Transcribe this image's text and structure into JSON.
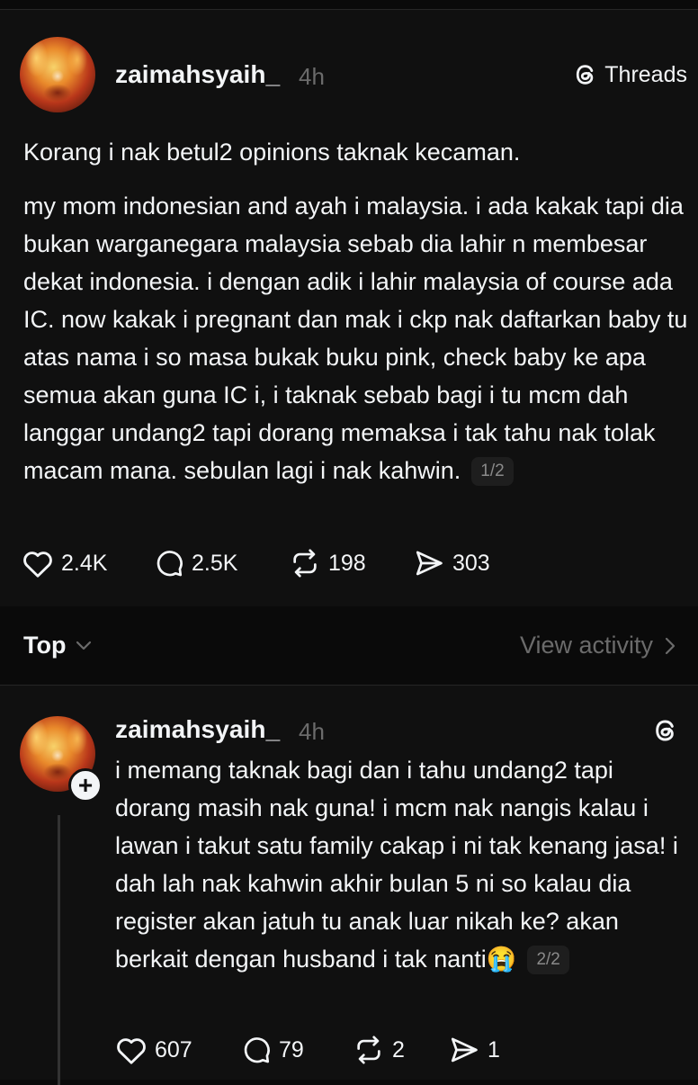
{
  "post": {
    "username": "zaimahsyaih_",
    "time": "4h",
    "brand_label": "Threads",
    "paragraph1": "Korang i nak betul2 opinions taknak kecaman.",
    "paragraph2": "my mom indonesian and ayah i malaysia. i ada kakak tapi dia bukan warganegara malaysia sebab dia lahir n membesar dekat indonesia. i dengan adik i lahir malaysia of course ada IC. now kakak i pregnant dan mak i ckp nak daftarkan baby tu atas nama i so masa bukak buku pink, check baby ke apa semua akan guna IC i, i taknak sebab bagi i tu mcm dah langgar undang2 tapi dorang memaksa i tak tahu nak tolak macam mana. sebulan lagi i nak kahwin.",
    "pager": "1/2",
    "likes": "2.4K",
    "replies": "2.5K",
    "reposts": "198",
    "shares": "303"
  },
  "filter": {
    "sort_label": "Top",
    "activity_label": "View activity"
  },
  "reply": {
    "username": "zaimahsyaih_",
    "time": "4h",
    "text": "i memang taknak bagi dan i tahu undang2 tapi dorang masih nak guna! i mcm nak nangis kalau i lawan i takut satu family cakap i ni tak kenang jasa! i dah lah nak kahwin akhir bulan 5 ni so kalau dia register akan jatuh tu anak luar nikah ke? akan berkait dengan husband i tak nanti😭",
    "pager": "2/2",
    "likes": "607",
    "replies": "79",
    "reposts": "2",
    "shares": "1"
  },
  "icons": {
    "brand": "threads-logo-icon",
    "like": "heart-icon",
    "reply": "comment-icon",
    "repost": "repost-icon",
    "share": "share-icon",
    "sort": "chevron-down-icon",
    "activity": "chevron-right-icon",
    "follow": "plus-icon"
  }
}
